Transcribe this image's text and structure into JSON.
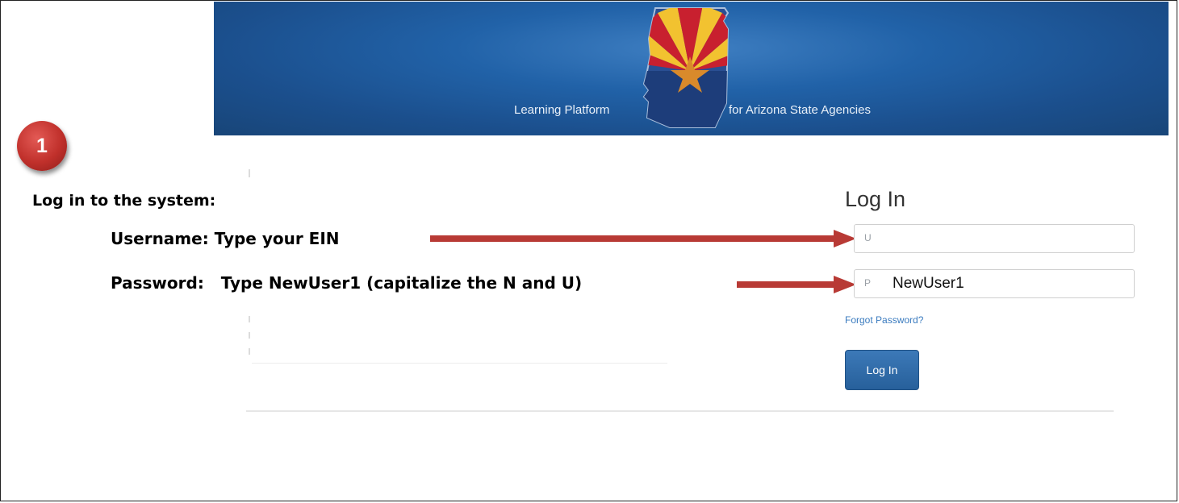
{
  "banner": {
    "left_text": "Learning Platform",
    "right_text": "for Arizona State Agencies",
    "logo_icon": "arizona-state-flag-icon",
    "background_color": "#1f5a9c"
  },
  "step": {
    "number": "1",
    "color": "#c0302b"
  },
  "instructions": {
    "title": "Log in to the system:",
    "username_line": "Username: Type your EIN",
    "password_line": "Password:   Type NewUser1 (capitalize the N and U)",
    "arrow_color": "#b83a35"
  },
  "login": {
    "title": "Log In",
    "username_placeholder": "U",
    "password_placeholder": "P",
    "password_value": "NewUser1",
    "forgot_link": "Forgot Password?",
    "button_label": "Log In",
    "button_color": "#2d6aa8"
  }
}
